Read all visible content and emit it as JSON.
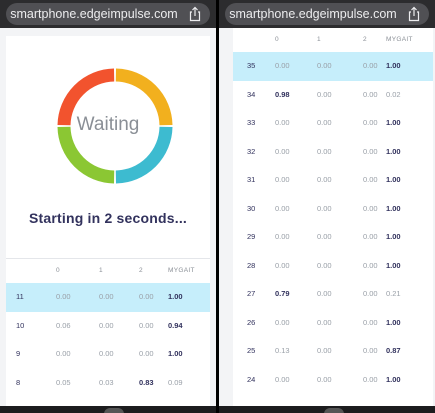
{
  "left": {
    "url": "smartphone.edgeimpulse.com",
    "status": "Waiting",
    "countdown": "Starting in 2 seconds...",
    "columns": [
      "",
      "0",
      "1",
      "2",
      "MYGAIT"
    ],
    "rows": [
      {
        "idx": "11",
        "c0": "0.00",
        "c1": "0.00",
        "c2": "0.00",
        "my": "1.00",
        "strong": "my",
        "highlight": true
      },
      {
        "idx": "10",
        "c0": "0.06",
        "c1": "0.00",
        "c2": "0.00",
        "my": "0.94",
        "strong": "my",
        "highlight": false
      },
      {
        "idx": "9",
        "c0": "0.00",
        "c1": "0.00",
        "c2": "0.00",
        "my": "1.00",
        "strong": "my",
        "highlight": false
      },
      {
        "idx": "8",
        "c0": "0.05",
        "c1": "0.03",
        "c2": "0.83",
        "my": "0.09",
        "strong": "c2",
        "highlight": false
      }
    ],
    "donut_colors": [
      "#f2b01e",
      "#3dbbd0",
      "#8bc733",
      "#f2532e"
    ]
  },
  "right": {
    "url": "smartphone.edgeimpulse.com",
    "columns": [
      "",
      "0",
      "1",
      "2",
      "MYGAIT"
    ],
    "rows": [
      {
        "idx": "35",
        "c0": "0.00",
        "c1": "0.00",
        "c2": "0.00",
        "my": "1.00",
        "strong": "my",
        "highlight": true
      },
      {
        "idx": "34",
        "c0": "0.98",
        "c1": "0.00",
        "c2": "0.00",
        "my": "0.02",
        "strong": "c0",
        "highlight": false
      },
      {
        "idx": "33",
        "c0": "0.00",
        "c1": "0.00",
        "c2": "0.00",
        "my": "1.00",
        "strong": "my",
        "highlight": false
      },
      {
        "idx": "32",
        "c0": "0.00",
        "c1": "0.00",
        "c2": "0.00",
        "my": "1.00",
        "strong": "my",
        "highlight": false
      },
      {
        "idx": "31",
        "c0": "0.00",
        "c1": "0.00",
        "c2": "0.00",
        "my": "1.00",
        "strong": "my",
        "highlight": false
      },
      {
        "idx": "30",
        "c0": "0.00",
        "c1": "0.00",
        "c2": "0.00",
        "my": "1.00",
        "strong": "my",
        "highlight": false
      },
      {
        "idx": "29",
        "c0": "0.00",
        "c1": "0.00",
        "c2": "0.00",
        "my": "1.00",
        "strong": "my",
        "highlight": false
      },
      {
        "idx": "28",
        "c0": "0.00",
        "c1": "0.00",
        "c2": "0.00",
        "my": "1.00",
        "strong": "my",
        "highlight": false
      },
      {
        "idx": "27",
        "c0": "0.79",
        "c1": "0.00",
        "c2": "0.00",
        "my": "0.21",
        "strong": "c0",
        "highlight": false
      },
      {
        "idx": "26",
        "c0": "0.00",
        "c1": "0.00",
        "c2": "0.00",
        "my": "1.00",
        "strong": "my",
        "highlight": false
      },
      {
        "idx": "25",
        "c0": "0.13",
        "c1": "0.00",
        "c2": "0.00",
        "my": "0.87",
        "strong": "my",
        "highlight": false
      },
      {
        "idx": "24",
        "c0": "0.00",
        "c1": "0.00",
        "c2": "0.00",
        "my": "1.00",
        "strong": "my",
        "highlight": false
      }
    ]
  },
  "icons": {
    "share": "share-icon"
  },
  "colors": {
    "highlight": "#c6eefb",
    "strong_text": "#32325d",
    "muted_text": "#9aa0a8"
  }
}
